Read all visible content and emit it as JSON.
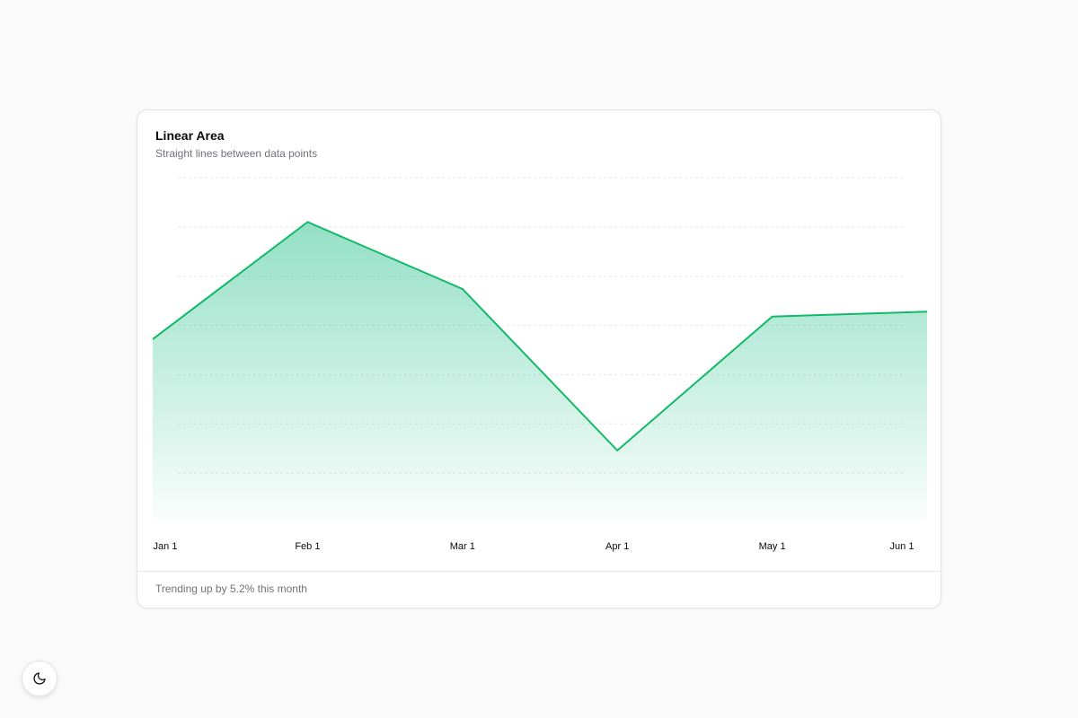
{
  "card": {
    "title": "Linear Area",
    "subtitle": "Straight lines between data points",
    "footer": "Trending up by 5.2% this month"
  },
  "theme_toggle": {
    "icon": "moon-icon"
  },
  "colors": {
    "accent": "#10b981",
    "line": "#12b968",
    "grid": "#e5e7eb"
  },
  "chart_data": {
    "type": "area",
    "title": "Linear Area",
    "subtitle": "Straight lines between data points",
    "xlabel": "",
    "ylabel": "",
    "x": [
      "Jan 1",
      "Feb 1",
      "Mar 1",
      "Apr 1",
      "May 1",
      "Jun 1"
    ],
    "series": [
      {
        "values": [
          186,
          305,
          237,
          73,
          209,
          214
        ]
      }
    ],
    "ylim": [
      0,
      350
    ],
    "grid": true,
    "legend": "none"
  }
}
